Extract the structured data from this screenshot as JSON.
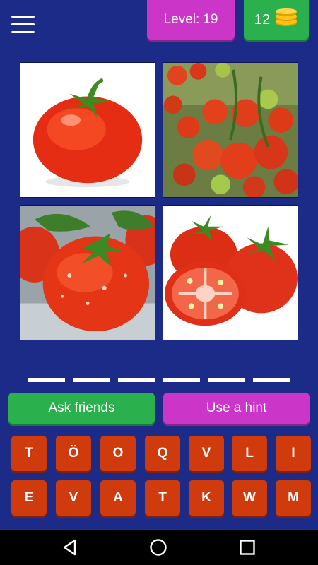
{
  "header": {
    "level_label": "Level:",
    "level_value": "19",
    "coins": "12",
    "menu_icon": "hamburger-menu-icon",
    "coin_icon": "coin-stack-icon"
  },
  "puzzle": {
    "images": [
      {
        "subject": "single tomato"
      },
      {
        "subject": "tomatoes on vine"
      },
      {
        "subject": "wet tomatoes with leaves"
      },
      {
        "subject": "whole and halved tomatoes"
      }
    ],
    "answer_slots": [
      "",
      "",
      "",
      "",
      "",
      ""
    ]
  },
  "actions": {
    "ask_friends": "Ask friends",
    "use_hint": "Use a hint"
  },
  "keyboard": {
    "row1": [
      "T",
      "Ö",
      "O",
      "Q",
      "V",
      "L",
      "I"
    ],
    "row2": [
      "E",
      "V",
      "A",
      "T",
      "K",
      "W",
      "M"
    ]
  },
  "navbar": {
    "back_icon": "back-triangle-icon",
    "home_icon": "home-circle-icon",
    "recents_icon": "recents-square-icon"
  },
  "colors": {
    "background": "#1c2a88",
    "green": "#2ab04c",
    "purple": "#cc36c8",
    "key": "#cf3b0c"
  }
}
